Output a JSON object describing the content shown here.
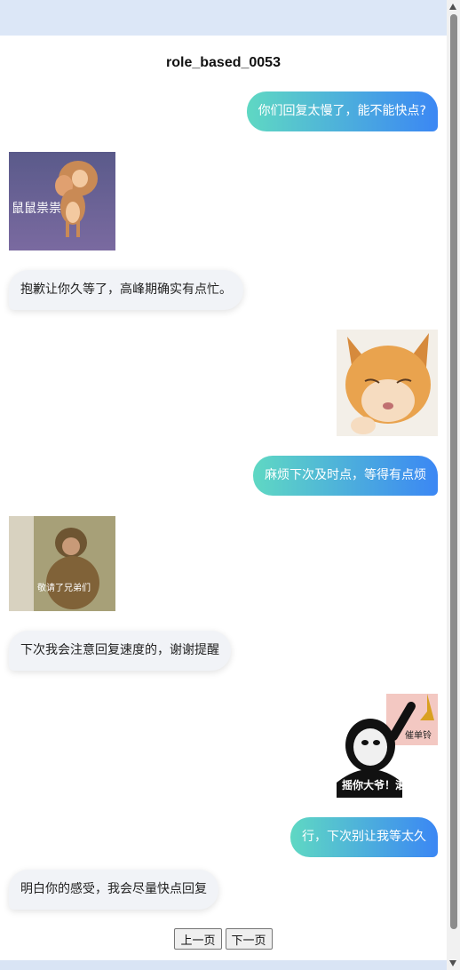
{
  "chat": {
    "title": "role_based_0053",
    "messages": [
      {
        "role": "user",
        "text": "你们回复太慢了，能不能快点?"
      },
      {
        "role": "bot",
        "sticker": "mouse-sticker",
        "caption": "鼠鼠祟祟"
      },
      {
        "role": "bot",
        "text": "抱歉让你久等了，高峰期确实有点忙。"
      },
      {
        "role": "user",
        "sticker": "cat-sticker"
      },
      {
        "role": "user",
        "text": "麻烦下次及时点，等得有点烦"
      },
      {
        "role": "bot",
        "sticker": "monkey-sticker",
        "caption": "敬请了兄弟们"
      },
      {
        "role": "bot",
        "text": "下次我会注意回复速度的，谢谢提醒"
      },
      {
        "role": "user",
        "sticker": "panda-meme-sticker",
        "caption": "摇你大爷！滚！！",
        "sign": "催单铃"
      },
      {
        "role": "user",
        "text": "行，下次别让我等太久"
      },
      {
        "role": "bot",
        "text": "明白你的感受，我会尽量快点回复"
      }
    ]
  },
  "pager": {
    "prev": "上一页",
    "next": "下一页"
  },
  "colors": {
    "user_gradient_start": "#5fd8c3",
    "user_gradient_end": "#3b87f4",
    "bot_bubble": "#f1f3f7"
  }
}
